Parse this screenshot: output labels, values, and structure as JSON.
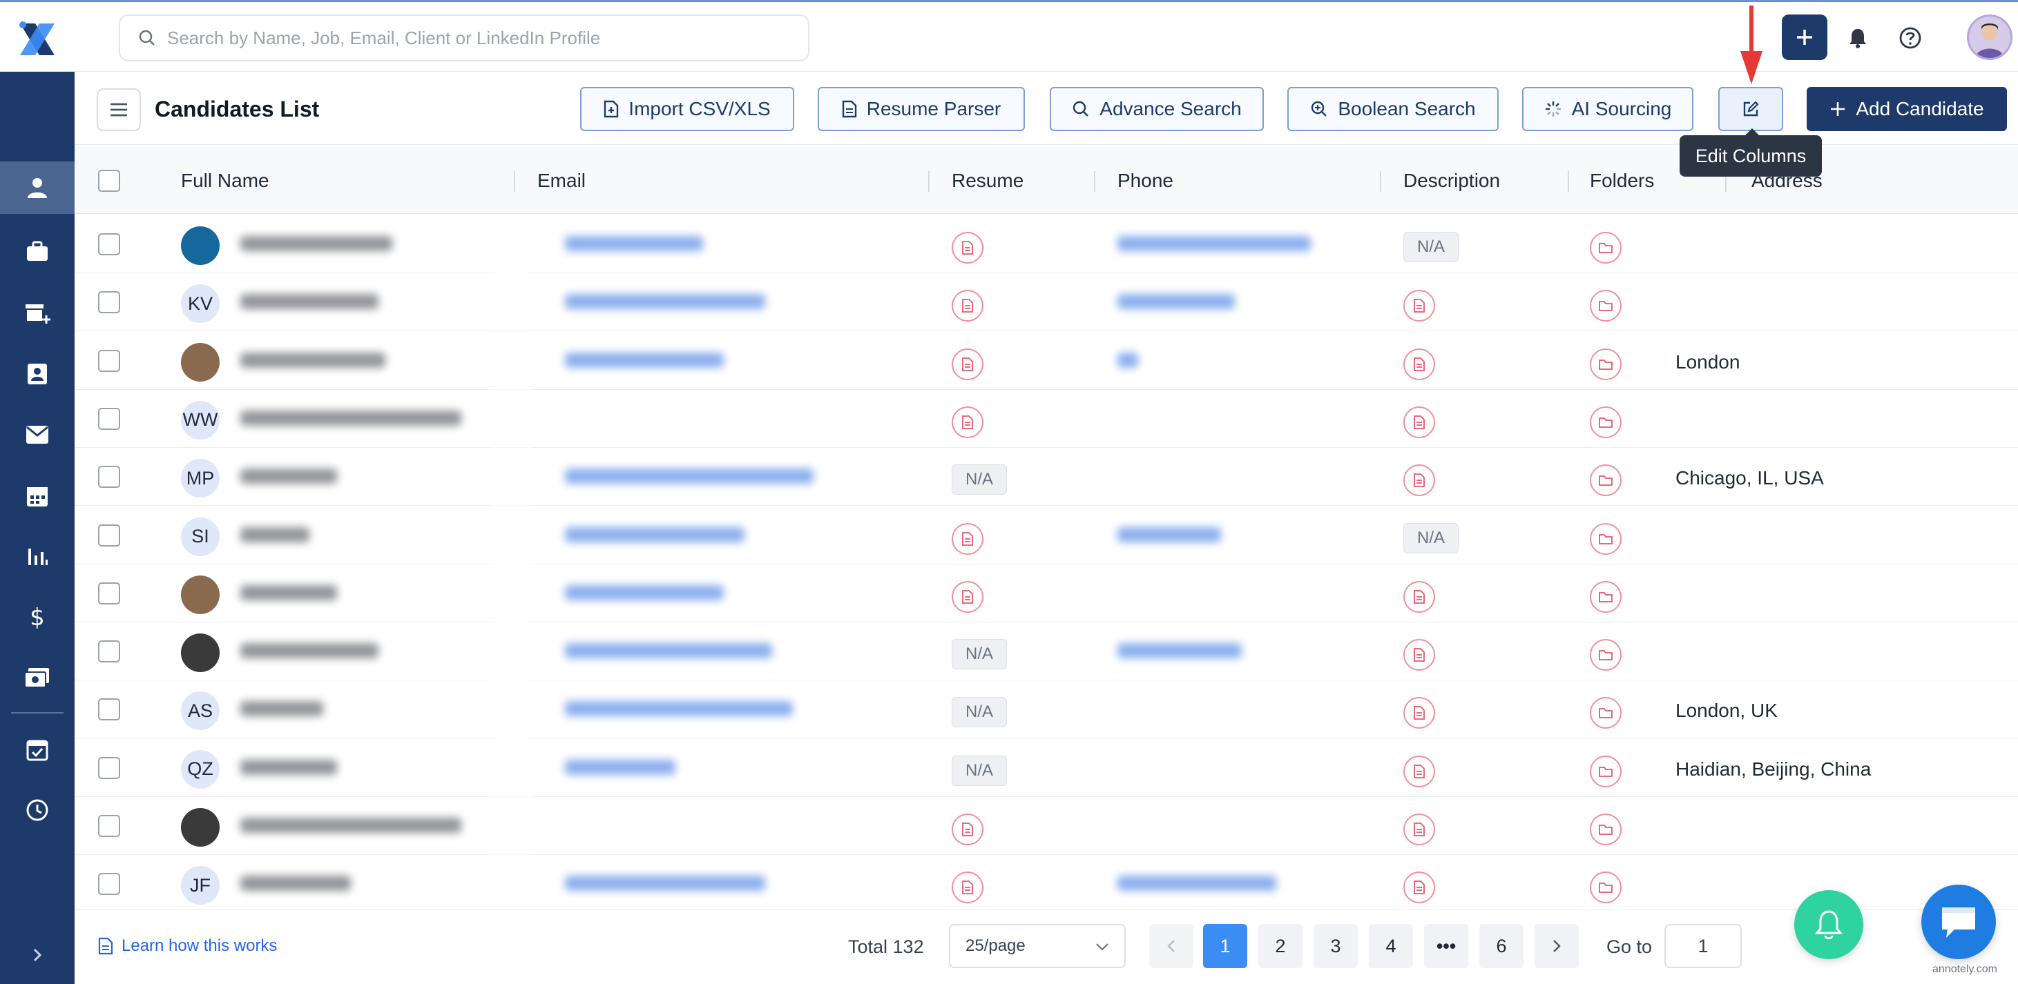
{
  "search": {
    "placeholder": "Search by Name, Job, Email, Client or LinkedIn Profile"
  },
  "header": {
    "title": "Candidates List",
    "buttons": {
      "import": "Import CSV/XLS",
      "resume_parser": "Resume Parser",
      "advance_search": "Advance Search",
      "boolean_search": "Boolean Search",
      "ai_sourcing": "AI Sourcing",
      "add_candidate": "Add Candidate"
    },
    "tooltip": "Edit Columns"
  },
  "table": {
    "columns": [
      "Full Name",
      "Email",
      "Resume",
      "Phone",
      "Description",
      "Folders",
      "Address"
    ],
    "rows": [
      {
        "initials": "",
        "avatar": "photo-blue",
        "resume": "icon",
        "description": "N/A",
        "address": ""
      },
      {
        "initials": "KV",
        "avatar": "initials",
        "resume": "icon",
        "description": "icon",
        "address": ""
      },
      {
        "initials": "",
        "avatar": "photo",
        "resume": "icon",
        "description": "icon",
        "address": "London"
      },
      {
        "initials": "WW",
        "avatar": "initials",
        "resume": "icon",
        "description": "icon",
        "address": ""
      },
      {
        "initials": "MP",
        "avatar": "initials",
        "resume": "N/A",
        "description": "icon",
        "address": "Chicago, IL, USA"
      },
      {
        "initials": "SI",
        "avatar": "initials",
        "resume": "icon",
        "description": "N/A",
        "address": ""
      },
      {
        "initials": "",
        "avatar": "photo",
        "resume": "icon",
        "description": "icon",
        "address": ""
      },
      {
        "initials": "",
        "avatar": "photo-dark",
        "resume": "N/A",
        "description": "icon",
        "address": ""
      },
      {
        "initials": "AS",
        "avatar": "initials",
        "resume": "N/A",
        "description": "icon",
        "address": "London, UK"
      },
      {
        "initials": "QZ",
        "avatar": "initials",
        "resume": "N/A",
        "description": "icon",
        "address": "Haidian, Beijing, China"
      },
      {
        "initials": "",
        "avatar": "photo-dark",
        "resume": "icon",
        "description": "icon",
        "address": ""
      },
      {
        "initials": "JF",
        "avatar": "initials",
        "resume": "icon",
        "description": "icon",
        "address": ""
      }
    ]
  },
  "footer": {
    "learn": "Learn how this works",
    "total": "Total 132",
    "per_page": "25/page",
    "pages": [
      "1",
      "2",
      "3",
      "4",
      "•••",
      "6"
    ],
    "goto_label": "Go to",
    "goto_value": "1"
  },
  "watermark": "annotely.com",
  "colors": {
    "brand": "#1e3a6b",
    "accent": "#3b8cf5",
    "danger": "#f1919c",
    "fab_green": "#2fd3a0"
  }
}
